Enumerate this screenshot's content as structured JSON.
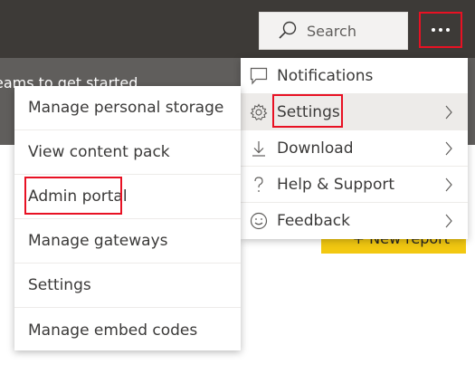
{
  "header": {
    "search_placeholder": "Search",
    "more_icon": "ellipsis-icon"
  },
  "banner": {
    "text": "eams to get started"
  },
  "new_report": {
    "label": "+ New report"
  },
  "menu_right": {
    "items": [
      {
        "label": "Notifications",
        "icon": "speech-bubble-icon",
        "has_submenu": false
      },
      {
        "label": "Settings",
        "icon": "gear-icon",
        "has_submenu": true
      },
      {
        "label": "Download",
        "icon": "download-icon",
        "has_submenu": true
      },
      {
        "label": "Help & Support",
        "icon": "question-icon",
        "has_submenu": true
      },
      {
        "label": "Feedback",
        "icon": "smiley-icon",
        "has_submenu": true
      }
    ]
  },
  "menu_left": {
    "items": [
      {
        "label": "Manage personal storage"
      },
      {
        "label": "View content pack"
      },
      {
        "label": "Admin portal"
      },
      {
        "label": "Manage gateways"
      },
      {
        "label": "Settings"
      },
      {
        "label": "Manage embed codes"
      }
    ]
  },
  "colors": {
    "header_bg": "#3d3a37",
    "banner_bg": "#605e5c",
    "highlight": "#e81123",
    "accent_yellow": "#f2c811"
  }
}
